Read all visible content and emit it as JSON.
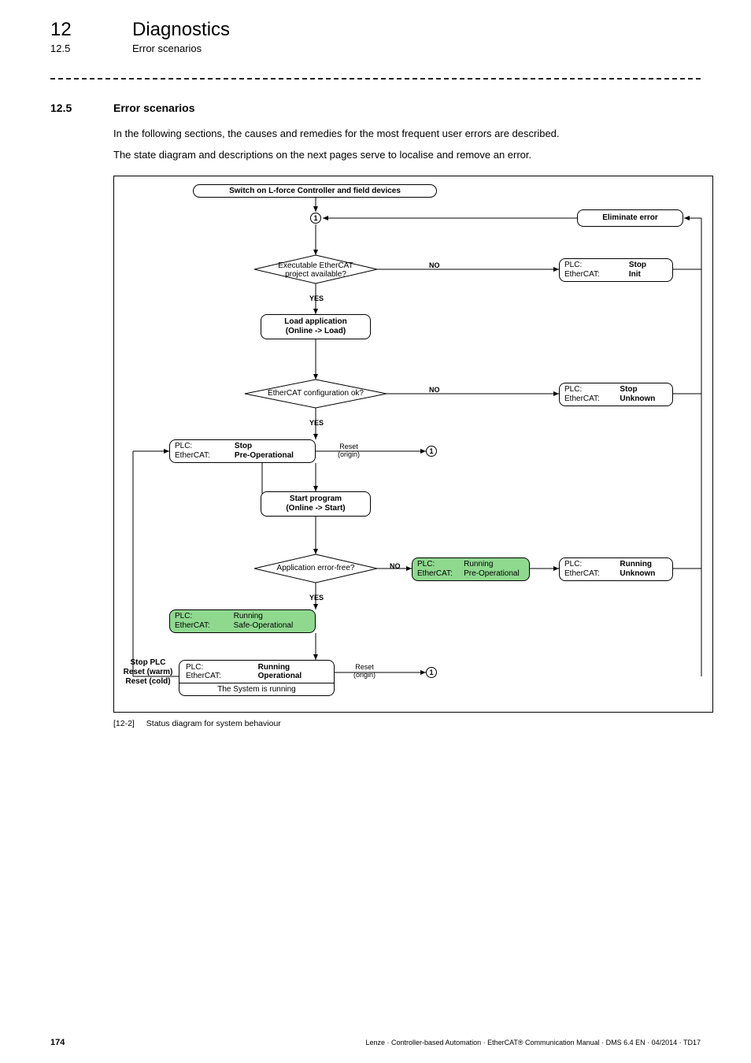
{
  "header": {
    "chapter_num": "12",
    "chapter_title": "Diagnostics",
    "section_num_small": "12.5",
    "section_title_small": "Error scenarios"
  },
  "section": {
    "num": "12.5",
    "title": "Error scenarios",
    "para1": "In the following sections, the causes and remedies for the most frequent user errors are described.",
    "para2": "The state diagram and descriptions on the next pages serve to localise and remove an error."
  },
  "diagram": {
    "start": "Switch on L-force Controller and field devices",
    "conn1": "1",
    "eliminate": "Eliminate error",
    "d1": "Executable EtherCAT\nproject available?",
    "no": "NO",
    "yes": "YES",
    "s_init": {
      "l1": "PLC:",
      "r1": "Stop",
      "l2": "EtherCAT:",
      "r2": "Init"
    },
    "p_load": "Load application\n(Online -> Load)",
    "d2": "EtherCAT configuration ok?",
    "s_unknown": {
      "l1": "PLC:",
      "r1": "Stop",
      "l2": "EtherCAT:",
      "r2": "Unknown"
    },
    "s_preop_stop": {
      "l1": "PLC:",
      "r1": "Stop",
      "l2": "EtherCAT:",
      "r2": "Pre-Operational"
    },
    "reset_origin": "Reset\n(origin)",
    "p_start": "Start program\n(Online -> Start)",
    "d3": "Application error-free?",
    "s_preop_run": {
      "l1": "PLC:",
      "r1": "Running",
      "l2": "EtherCAT:",
      "r2": "Pre-Operational"
    },
    "s_run_unknown": {
      "l1": "PLC:",
      "r1": "Running",
      "l2": "EtherCAT:",
      "r2": "Unknown"
    },
    "s_safeop": {
      "l1": "PLC:",
      "r1": "Running",
      "l2": "EtherCAT:",
      "r2": "Safe-Operational"
    },
    "s_op": {
      "l1": "PLC:",
      "r1": "Running",
      "l2": "EtherCAT:",
      "r2": "Operational"
    },
    "op_sub": "The System is running",
    "side": "Stop PLC\nReset (warm)\nReset (cold)"
  },
  "caption": {
    "id": "[12-2]",
    "text": "Status diagram for system behaviour"
  },
  "footer": {
    "page": "174",
    "line": "Lenze · Controller-based Automation · EtherCAT® Communication Manual · DMS 6.4 EN · 04/2014 · TD17"
  }
}
